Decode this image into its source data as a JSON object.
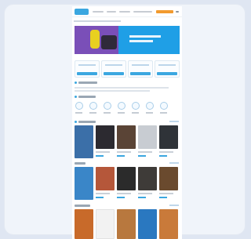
{
  "window": {
    "background": "#dfe6f2",
    "card_color": "#f0f4fa"
  },
  "header": {
    "logo_icon": "brand-logo-icon",
    "nav_links": [
      "nav-link-1",
      "nav-link-2",
      "nav-link-3",
      "nav-link-4"
    ],
    "cta_color": "#f29a2e"
  },
  "hero": {
    "background": "#1f9fe6"
  },
  "feature_cards": [
    "feature-card-1",
    "feature-card-2",
    "feature-card-3",
    "feature-card-4"
  ],
  "categories": [
    "category-1",
    "category-2",
    "category-3",
    "category-4",
    "category-5",
    "category-6",
    "category-7"
  ],
  "products_row_1": [
    "#3b6fa8",
    "#2c2a30",
    "#5a4436",
    "#c8ccd2",
    "#2f3338",
    "#9aa1a8"
  ],
  "products_row_2": [
    "#3a86c8",
    "#b5573a",
    "#2b2b2b",
    "#3e3b38",
    "#6a4a2e",
    "#d2cfc8"
  ],
  "products_row_3": [
    "#c86a2a",
    "#f2f2f2",
    "#b8783e",
    "#2a78c0",
    "#c97a3a"
  ],
  "accent_color": "#3ba7e0"
}
